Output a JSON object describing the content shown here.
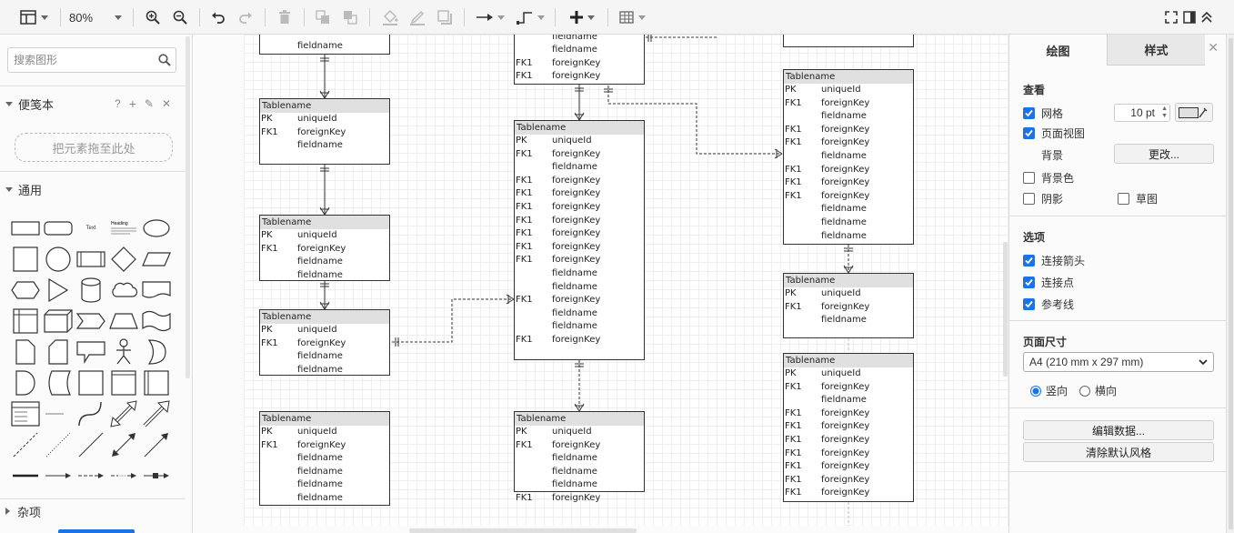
{
  "toolbar": {
    "zoom": "80%",
    "buttons": [
      "view-toggle",
      "zoom-in",
      "zoom-out",
      "undo",
      "redo",
      "delete",
      "to-front",
      "to-back",
      "fill-color",
      "line-color",
      "shadow",
      "connection",
      "waypoints",
      "insert",
      "table"
    ]
  },
  "sidebar": {
    "search_placeholder": "搜索图形",
    "scratchpad": {
      "title": "便笺本",
      "help": "?",
      "add": "+",
      "edit": "✎",
      "close": "✕",
      "drop_text": "把元素拖至此处"
    },
    "general_title": "通用",
    "misc_title": "杂项",
    "shape_text_label": "Text",
    "shape_heading_label": "Heading"
  },
  "canvas": {
    "tables": [
      {
        "id": "t1",
        "title": "",
        "rows": [
          [
            "",
            "fieldname"
          ]
        ]
      },
      {
        "id": "t2",
        "title": "Tablename",
        "rows": [
          [
            "PK",
            "uniqueId"
          ],
          [
            "FK1",
            "foreignKey"
          ],
          [
            "",
            "fieldname"
          ]
        ]
      },
      {
        "id": "t3",
        "title": "Tablename",
        "rows": [
          [
            "PK",
            "uniqueId"
          ],
          [
            "FK1",
            "foreignKey"
          ],
          [
            "",
            "fieldname"
          ],
          [
            "",
            "fieldname"
          ]
        ]
      },
      {
        "id": "t4",
        "title": "Tablename",
        "rows": [
          [
            "PK",
            "uniqueId"
          ],
          [
            "FK1",
            "foreignKey"
          ],
          [
            "",
            "fieldname"
          ],
          [
            "",
            "fieldname"
          ]
        ]
      },
      {
        "id": "t5",
        "title": "Tablename",
        "rows": [
          [
            "PK",
            "uniqueId"
          ],
          [
            "FK1",
            "foreignKey"
          ],
          [
            "",
            "fieldname"
          ],
          [
            "",
            "fieldname"
          ],
          [
            "",
            "fieldname"
          ],
          [
            "",
            "fieldname"
          ]
        ]
      },
      {
        "id": "t6",
        "title": "",
        "rows": [
          [
            "",
            "fieldname"
          ],
          [
            "",
            "fieldname"
          ],
          [
            "FK1",
            "foreignKey"
          ],
          [
            "FK1",
            "foreignKey"
          ]
        ]
      },
      {
        "id": "t7",
        "title": "Tablename",
        "rows": [
          [
            "PK",
            "uniqueId"
          ],
          [
            "FK1",
            "foreignKey"
          ],
          [
            "",
            "fieldname"
          ],
          [
            "FK1",
            "foreignKey"
          ],
          [
            "FK1",
            "foreignKey"
          ],
          [
            "FK1",
            "foreignKey"
          ],
          [
            "FK1",
            "foreignKey"
          ],
          [
            "FK1",
            "foreignKey"
          ],
          [
            "FK1",
            "foreignKey"
          ],
          [
            "FK1",
            "foreignKey"
          ],
          [
            "",
            "fieldname"
          ],
          [
            "",
            "fieldname"
          ],
          [
            "FK1",
            "foreignKey"
          ],
          [
            "",
            "fieldname"
          ],
          [
            "",
            "fieldname"
          ],
          [
            "FK1",
            "foreignKey"
          ]
        ]
      },
      {
        "id": "t8",
        "title": "Tablename",
        "rows": [
          [
            "PK",
            "uniqueId"
          ],
          [
            "FK1",
            "foreignKey"
          ],
          [
            "",
            "fieldname"
          ],
          [
            "",
            "fieldname"
          ],
          [
            "",
            "fieldname"
          ],
          [
            "FK1",
            "foreignKey"
          ]
        ]
      },
      {
        "id": "t9",
        "title": "",
        "rows": []
      },
      {
        "id": "t10",
        "title": "Tablename",
        "rows": [
          [
            "PK",
            "uniqueId"
          ],
          [
            "FK1",
            "foreignKey"
          ],
          [
            "",
            "fieldname"
          ],
          [
            "FK1",
            "foreignKey"
          ],
          [
            "FK1",
            "foreignKey"
          ],
          [
            "",
            "fieldname"
          ],
          [
            "FK1",
            "foreignKey"
          ],
          [
            "FK1",
            "foreignKey"
          ],
          [
            "FK1",
            "foreignKey"
          ],
          [
            "",
            "fieldname"
          ],
          [
            "",
            "fieldname"
          ],
          [
            "",
            "fieldname"
          ]
        ]
      },
      {
        "id": "t11",
        "title": "Tablename",
        "rows": [
          [
            "PK",
            "uniqueId"
          ],
          [
            "FK1",
            "foreignKey"
          ],
          [
            "",
            "fieldname"
          ]
        ]
      },
      {
        "id": "t12",
        "title": "Tablename",
        "rows": [
          [
            "PK",
            "uniqueId"
          ],
          [
            "FK1",
            "foreignKey"
          ],
          [
            "",
            "fieldname"
          ],
          [
            "FK1",
            "foreignKey"
          ],
          [
            "FK1",
            "foreignKey"
          ],
          [
            "FK1",
            "foreignKey"
          ],
          [
            "FK1",
            "foreignKey"
          ],
          [
            "FK1",
            "foreignKey"
          ],
          [
            "FK1",
            "foreignKey"
          ],
          [
            "FK1",
            "foreignKey"
          ]
        ]
      }
    ]
  },
  "panel": {
    "tab_diagram": "绘图",
    "tab_style": "样式",
    "close": "✕",
    "view_heading": "查看",
    "grid_label": "网格",
    "grid_checked": true,
    "grid_size": "10 pt",
    "grid_color": "#e0e0e0",
    "page_view_label": "页面视图",
    "page_view_checked": true,
    "background_label": "背景",
    "change_button": "更改...",
    "bg_color_label": "背景色",
    "bg_color_checked": false,
    "shadow_label": "阴影",
    "shadow_checked": false,
    "sketch_label": "草图",
    "sketch_checked": false,
    "options_heading": "选项",
    "connection_arrows_label": "连接箭头",
    "connection_points_label": "连接点",
    "guides_label": "参考线",
    "page_size_heading": "页面尺寸",
    "page_size_value": "A4 (210 mm x 297 mm)",
    "portrait_label": "竖向",
    "landscape_label": "横向",
    "edit_data_button": "编辑数据...",
    "clear_style_button": "清除默认风格"
  }
}
